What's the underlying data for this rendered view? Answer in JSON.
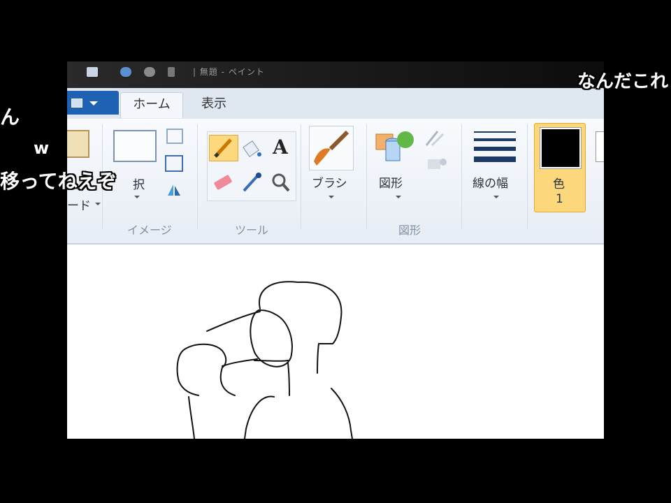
{
  "window": {
    "title": "| 無題 - ペイント",
    "tabs": {
      "home": "ホーム",
      "view": "表示"
    }
  },
  "ribbon": {
    "clipboard_label": "ード",
    "select_label": "択",
    "groups": {
      "image": "イメージ",
      "tools": "ツール",
      "shapes": "図形"
    },
    "brush_label": "ブラシ",
    "shapes_label": "図形",
    "stroke_label": "線の幅",
    "color1_label_a": "色",
    "color1_label_b": "1",
    "color1_value": "#000000",
    "accent_color": "#fdd77b"
  },
  "comments": {
    "c1": "ん",
    "c2": "w",
    "c3": "移ってねえぞ",
    "c4": "なんだこれ"
  }
}
